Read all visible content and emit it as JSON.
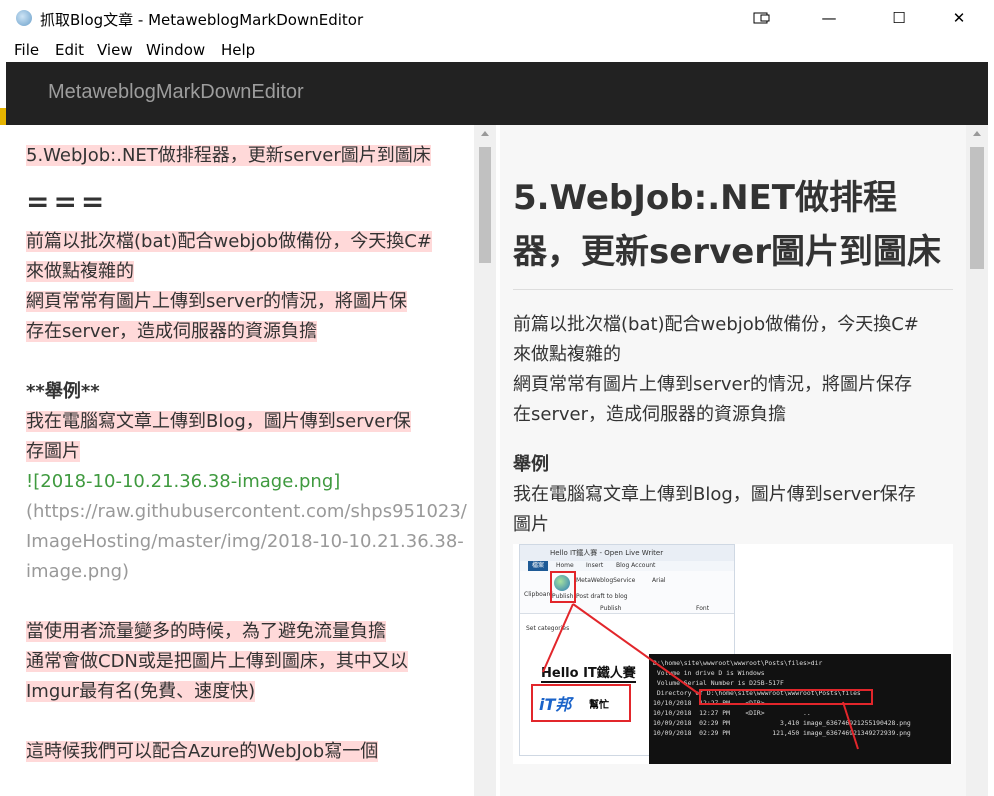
{
  "window": {
    "title": "抓取Blog文章 - MetaweblogMarkDownEditor",
    "minimize": "—",
    "maximize": "☐",
    "close": "✕"
  },
  "menu": {
    "items": [
      "File",
      "Edit",
      "View",
      "Window",
      "Help"
    ]
  },
  "header": {
    "brand": "MetaweblogMarkDownEditor"
  },
  "editor": {
    "title_line": "5.WebJob:.NET做排程器，更新server圖片到圖床",
    "heading_marker": "===",
    "para1_line1": "前篇以批次檔(bat)配合webjob做備份，今天換C#",
    "para1_line2": "來做點複雜的",
    "para1_line3": "網頁常常有圖片上傳到server的情況，將圖片保",
    "para1_line4": "存在server，造成伺服器的資源負擔",
    "bold_heading": "**舉例**",
    "para2_line1": "我在電腦寫文章上傳到Blog，圖片傳到server保",
    "para2_line2": "存圖片",
    "image_alt": "![2018-10-10.21.36.38-image.png]",
    "image_url_1": "(https://raw.githubusercontent.com/shps951023/",
    "image_url_2": "ImageHosting/master/img/2018-10-10.21.36.38-",
    "image_url_3": "image.png)",
    "para3_line1": "當使用者流量變多的時候，為了避免流量負擔",
    "para3_line2": "通常會做CDN或是把圖片上傳到圖床，其中又以",
    "para3_line3": "Imgur最有名(免費、速度快)",
    "para4_line1": "這時候我們可以配合Azure的WebJob寫一個"
  },
  "preview": {
    "title": "5.WebJob:.NET做排程器，更新server圖片到圖床",
    "para1_line1": "前篇以批次檔(bat)配合webjob做備份，今天換C#",
    "para1_line2": "來做點複雜的",
    "para1_line3": "網頁常常有圖片上傳到server的情況，將圖片保存",
    "para1_line4": "在server，造成伺服器的資源負擔",
    "bold_heading": "舉例",
    "para2_line1": "我在電腦寫文章上傳到Blog，圖片傳到server保存",
    "para2_line2": "圖片",
    "screenshot": {
      "lw_title": "Hello IT鐵人賽 - Open Live Writer",
      "tab_file": "檔案",
      "tab_home": "Home",
      "tab_insert": "Insert",
      "tab_blog": "Blog Account",
      "clipboard": "Clipboard",
      "publish": "Publish",
      "post_draft": "Post draft to blog",
      "service": "MetaWeblogService",
      "font": "Arial",
      "font_label": "Font",
      "publish_label": "Publish",
      "categories": "Set categories",
      "hello": "Hello IT鐵人賽",
      "itbang": "iT邦",
      "itbang_sub": "幫忙",
      "console_lines": [
        "D:\\home\\site\\wwwroot\\wwwroot\\Posts\\files>dir",
        " Volume in drive D is Windows",
        " Volume Serial Number is D25B-517F",
        "",
        " Directory of D:\\home\\site\\wwwroot\\wwwroot\\Posts\\files",
        "",
        "10/10/2018  12:27 PM    <DIR>          .",
        "10/10/2018  12:27 PM    <DIR>          ..",
        "10/09/2018  02:29 PM             3,410 image_636746921255190428.png",
        "10/09/2018  02:29 PM           121,450 image_636746921349272939.png"
      ]
    }
  },
  "colors": {
    "header_bg": "#222222",
    "brand": "#9d9d9d",
    "md_highlight": "#ffd9d9",
    "link_green": "#3f9a3f",
    "url_gray": "#999999",
    "preview_bg": "#f7f7f7"
  }
}
